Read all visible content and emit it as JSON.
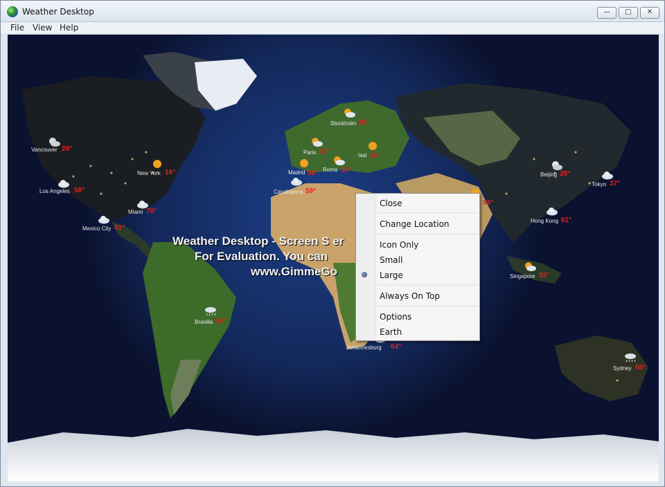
{
  "window": {
    "title": "Weather Desktop"
  },
  "menu": {
    "file": "File",
    "view": "View",
    "help": "Help"
  },
  "watermark": {
    "line1": "Weather Desktop - Screen S                          er",
    "line2": "For Evaluation. You can",
    "line3": "www.GimmeGo"
  },
  "cities": [
    {
      "name": "Vancouver",
      "temp": "28°",
      "icon": "partly-cloudy-night-icon"
    },
    {
      "name": "New York",
      "temp": "16°",
      "icon": "sun-icon"
    },
    {
      "name": "Los Angeles",
      "temp": "58°",
      "icon": "cloud-icon"
    },
    {
      "name": "Miami",
      "temp": "70°",
      "icon": "cloud-icon"
    },
    {
      "name": "Mexico City",
      "temp": "41°",
      "icon": "cloud-icon"
    },
    {
      "name": "Brasilia",
      "temp": "54°",
      "icon": "rain-icon"
    },
    {
      "name": "Stockholm",
      "temp": "36°",
      "icon": "partly-cloudy-icon"
    },
    {
      "name": "Paris",
      "temp": "42°",
      "icon": "partly-cloudy-icon"
    },
    {
      "name": "Iasi",
      "temp": "34°",
      "icon": "sun-icon"
    },
    {
      "name": "Madrid",
      "temp": "52°",
      "icon": "sun-icon"
    },
    {
      "name": "Roma",
      "temp": "50°",
      "icon": "partly-cloudy-icon"
    },
    {
      "name": "Casablanca",
      "temp": "59°",
      "icon": "cloud-icon"
    },
    {
      "name": "",
      "temp": "59°",
      "icon": "sun-icon"
    },
    {
      "name": "Johannesburg",
      "temp": "64°",
      "icon": "cloud-icon"
    },
    {
      "name": "Beijing",
      "temp": "28°",
      "icon": "moon-cloud-icon"
    },
    {
      "name": "Tokyo",
      "temp": "37°",
      "icon": "cloud-icon"
    },
    {
      "name": "Hong Kong",
      "temp": "61°",
      "icon": "cloud-icon"
    },
    {
      "name": "Singapore",
      "temp": "82°",
      "icon": "partly-cloudy-icon"
    },
    {
      "name": "Sydney",
      "temp": "68°",
      "icon": "rain-icon"
    }
  ],
  "context_menu": {
    "close": "Close",
    "change_location": "Change Location",
    "icon_only": "Icon Only",
    "small": "Small",
    "large": "Large",
    "always_on_top": "Always On Top",
    "options": "Options",
    "earth": "Earth",
    "selected": "Large"
  }
}
